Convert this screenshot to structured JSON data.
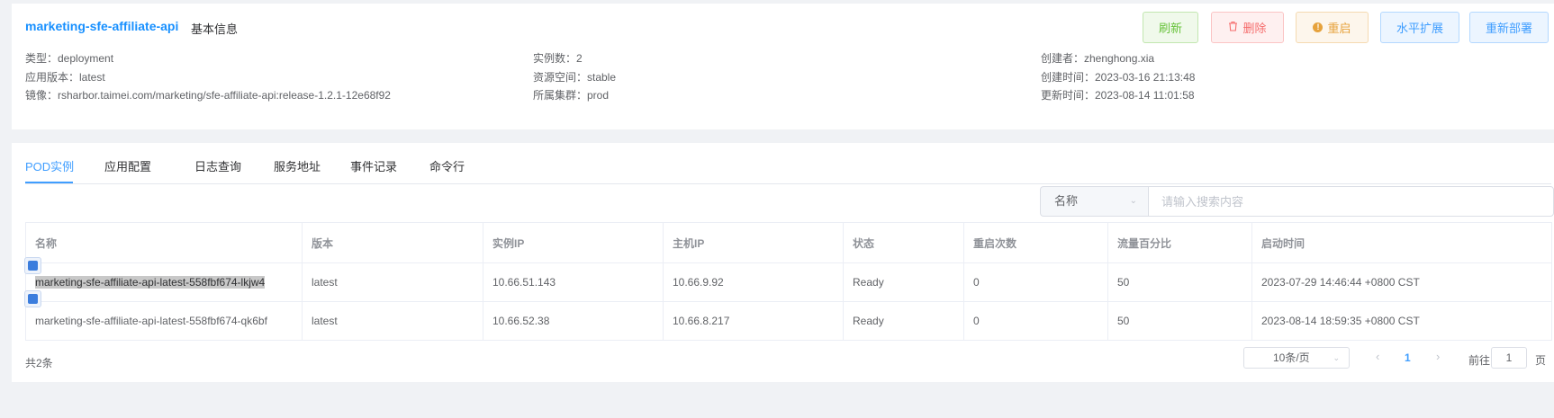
{
  "header": {
    "app_name": "marketing-sfe-affiliate-api",
    "section": "基本信息"
  },
  "actions": {
    "refresh": "刷新",
    "delete": "删除",
    "restart": "重启",
    "scale": "水平扩展",
    "redeploy": "重新部署"
  },
  "info": {
    "type": "类型：deployment",
    "version": "应用版本：latest",
    "image": "镜像：rsharbor.taimei.com/marketing/sfe-affiliate-api:release-1.2.1-12e68f92",
    "replicas": "实例数：2",
    "namespace": "资源空间：stable",
    "cluster": "所属集群：prod",
    "creator": "创建者：zhenghong.xia",
    "created": "创建时间：2023-03-16 21:13:48",
    "updated": "更新时间：2023-08-14 11:01:58"
  },
  "tabs": [
    "POD实例",
    "应用配置",
    "日志查询",
    "服务地址",
    "事件记录",
    "命令行"
  ],
  "search": {
    "field": "名称",
    "placeholder": "请输入搜索内容"
  },
  "table": {
    "columns": [
      "名称",
      "版本",
      "实例IP",
      "主机IP",
      "状态",
      "重启次数",
      "流量百分比",
      "启动时间"
    ],
    "rows": [
      [
        "marketing-sfe-affiliate-api-latest-558fbf674-lkjw4",
        "latest",
        "10.66.51.143",
        "10.66.9.92",
        "Ready",
        "0",
        "50",
        "2023-07-29 14:46:44 +0800 CST"
      ],
      [
        "marketing-sfe-affiliate-api-latest-558fbf674-qk6bf",
        "latest",
        "10.66.52.38",
        "10.66.8.217",
        "Ready",
        "0",
        "50",
        "2023-08-14 18:59:35 +0800 CST"
      ]
    ]
  },
  "pagination": {
    "total": "共2条",
    "page_size": "10条/页",
    "current": "1",
    "goto_label": "前往",
    "goto_value": "1",
    "goto_suffix": "页"
  },
  "colors": {
    "accent": "#409eff",
    "title": "#1890ff",
    "success": "#67c23a",
    "danger": "#f56c6c",
    "warning": "#e6a23c"
  }
}
